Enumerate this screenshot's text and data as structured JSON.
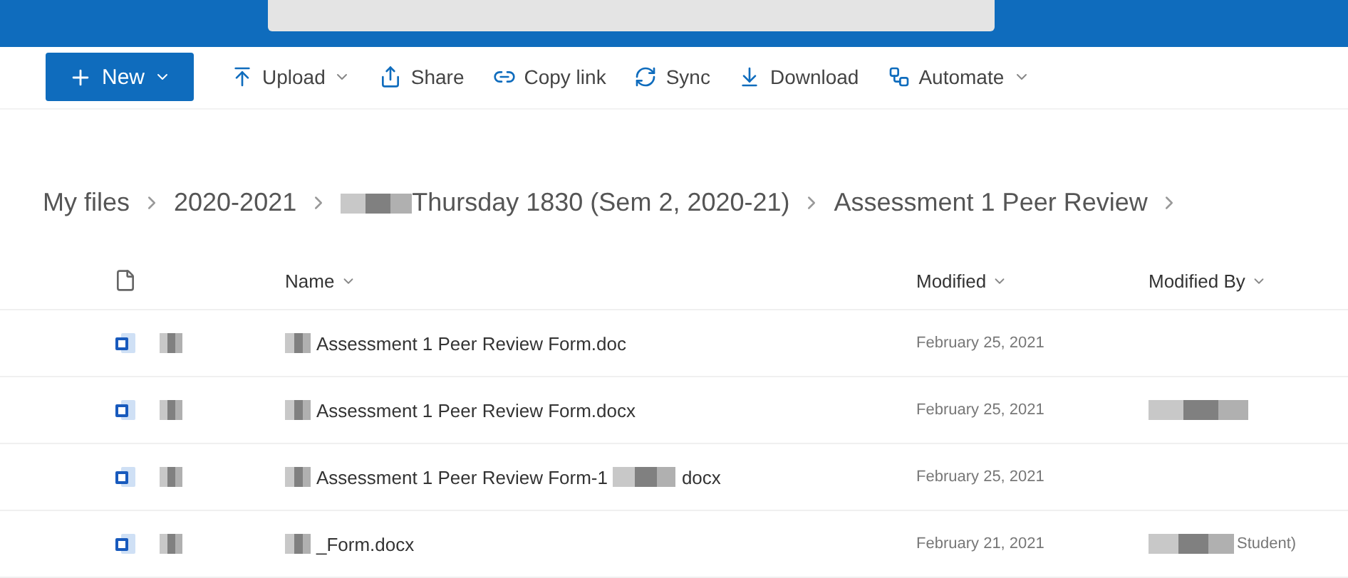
{
  "toolbar": {
    "new_button": "New",
    "actions": [
      {
        "kind": "upload",
        "label": "Upload",
        "dropdown": true
      },
      {
        "kind": "share",
        "label": "Share",
        "dropdown": false
      },
      {
        "kind": "link",
        "label": "Copy link",
        "dropdown": false
      },
      {
        "kind": "sync",
        "label": "Sync",
        "dropdown": false
      },
      {
        "kind": "download",
        "label": "Download",
        "dropdown": false
      },
      {
        "kind": "automate",
        "label": "Automate",
        "dropdown": true
      }
    ]
  },
  "breadcrumb": [
    {
      "label": "My files",
      "redacted": false
    },
    {
      "label": "2020-2021",
      "redacted": false
    },
    {
      "label": "Thursday 1830 (Sem 2, 2020-21)",
      "redacted": true
    },
    {
      "label": "Assessment 1 Peer Review",
      "redacted": false
    }
  ],
  "table": {
    "columns": [
      "Name",
      "Modified",
      "Modified By"
    ],
    "rows": [
      {
        "name": "Assessment 1 Peer Review Form.doc",
        "name_suffix": "",
        "modified": "February 25, 2021",
        "modified_by": "",
        "by_redacted": false
      },
      {
        "name": "Assessment 1 Peer Review Form.docx",
        "name_suffix": "",
        "modified": "February 25, 2021",
        "modified_by": "",
        "by_redacted": true
      },
      {
        "name": "Assessment 1 Peer Review Form-1",
        "name_suffix": "docx",
        "modified": "February 25, 2021",
        "modified_by": "",
        "by_redacted": false
      },
      {
        "name": "_Form.docx",
        "name_suffix": "",
        "modified": "February 21, 2021",
        "modified_by": "Student)",
        "by_redacted": true
      }
    ]
  }
}
